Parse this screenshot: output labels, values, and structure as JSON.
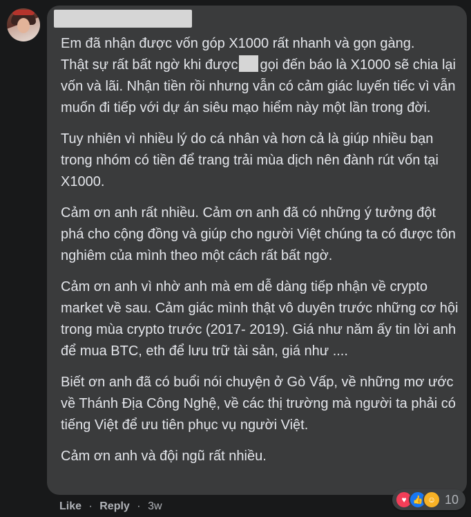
{
  "comment": {
    "paragraphs": [
      "Em đã nhận được vốn góp X1000 rất nhanh và gọn gàng.",
      "Tuy nhiên vì nhiều lý do cá nhân và hơn cả là giúp nhiều bạn trong nhóm có tiền để trang trải mùa dịch nên đành rút vốn tại X1000.",
      "Cảm ơn anh rất nhiều. Cảm ơn anh đã có những ý tưởng đột phá cho cộng đồng và giúp cho người Việt chúng ta có được tôn nghiêm của mình theo một cách rất bất ngờ.",
      "Cảm ơn anh vì nhờ anh mà em dễ dàng tiếp nhận về crypto market về sau. Cảm giác mình thật vô duyên trước những cơ hội trong mùa crypto trước (2017- 2019). Giá như năm ấy tin lời anh để mua BTC, eth để lưu trữ tài sản, giá như ....",
      "Biết ơn anh đã có buổi nói chuyện ở Gò Vấp, về những mơ ước về Thánh Địa Công Nghệ, về các thị trường mà người ta phải có tiếng Việt để ưu tiên phục vụ người Việt.",
      "Cảm ơn anh và đội ngũ rất nhiều."
    ],
    "p1_part_a": "Thật sự rất bất ngờ khi được",
    "p1_part_b": "gọi đến báo là X1000 sẽ chia lại vốn và lãi. Nhận tiền rồi nhưng vẫn có cảm giác luyến tiếc vì vẫn muốn đi tiếp với dự án siêu mạo hiểm này một lần trong đời."
  },
  "actions": {
    "like": "Like",
    "reply": "Reply",
    "separator": "·",
    "time": "3w"
  },
  "reactions": {
    "icons": [
      "love-icon",
      "like-icon",
      "care-icon"
    ],
    "count": "10",
    "colors": {
      "love": "#f33e58",
      "like": "#1877f2",
      "care": "#f7b125"
    }
  }
}
